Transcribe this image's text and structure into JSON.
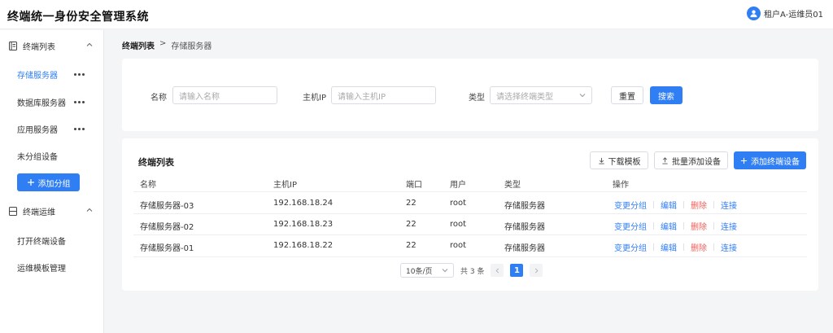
{
  "header": {
    "title": "终端统一身份安全管理系统",
    "user": "租户A-运维员01"
  },
  "sidebar": {
    "group1": {
      "label": "终端列表",
      "items": [
        "存储服务器",
        "数据库服务器",
        "应用服务器",
        "未分组设备"
      ]
    },
    "add_group_label": "添加分组",
    "group2": {
      "label": "终端运维",
      "items": [
        "打开终端设备",
        "运维模板管理"
      ]
    }
  },
  "breadcrumb": {
    "root": "终端列表",
    "sep": ">",
    "current": "存储服务器"
  },
  "filters": {
    "name_label": "名称",
    "name_placeholder": "请输入名称",
    "ip_label": "主机IP",
    "ip_placeholder": "请输入主机IP",
    "type_label": "类型",
    "type_placeholder": "请选择终端类型",
    "reset_label": "重置",
    "search_label": "搜索"
  },
  "list": {
    "title": "终端列表",
    "download_label": "下载模板",
    "batch_label": "批量添加设备",
    "add_label": "添加终端设备",
    "columns": {
      "name": "名称",
      "ip": "主机IP",
      "port": "端口",
      "user": "用户",
      "type": "类型",
      "ops": "操作"
    },
    "rows": [
      {
        "name": "存储服务器-03",
        "ip": "192.168.18.24",
        "port": "22",
        "user": "root",
        "type": "存储服务器"
      },
      {
        "name": "存储服务器-02",
        "ip": "192.168.18.23",
        "port": "22",
        "user": "root",
        "type": "存储服务器"
      },
      {
        "name": "存储服务器-01",
        "ip": "192.168.18.22",
        "port": "22",
        "user": "root",
        "type": "存储服务器"
      }
    ],
    "ops": {
      "change_group": "变更分组",
      "edit": "编辑",
      "delete": "删除",
      "connect": "连接"
    }
  },
  "pagination": {
    "page_size": "10条/页",
    "total": "共 3 条",
    "current_page": "1"
  },
  "colors": {
    "primary": "#2f7ef3",
    "danger": "#f0605a"
  },
  "icons": [
    "user-avatar-icon",
    "list-icon",
    "chevron-up-icon",
    "more-icon",
    "plus-icon",
    "server-icon",
    "chevron-down-icon",
    "download-icon",
    "upload-icon",
    "chevron-left-icon",
    "chevron-right-icon"
  ]
}
